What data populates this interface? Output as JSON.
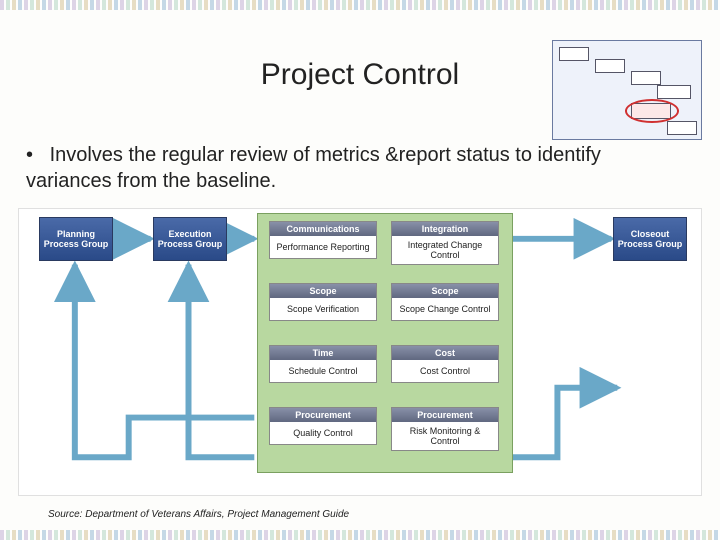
{
  "title": "Project Control",
  "bullet": "Involves the regular review of metrics &report status to identify variances from the baseline.",
  "source": "Source: Department of Veterans Affairs, Project Management Guide",
  "thumb": {
    "boxes": [
      "",
      "",
      "",
      "",
      "",
      ""
    ],
    "highlight_index": 4
  },
  "diagram": {
    "left_box": "Planning Process Group",
    "mid_left_box": "Execution Process Group",
    "right_box": "Closeout Process Group",
    "cells": [
      {
        "hdr": "Communications",
        "body": "Performance Reporting"
      },
      {
        "hdr": "Integration",
        "body": "Integrated Change Control"
      },
      {
        "hdr": "Scope",
        "body": "Scope Verification"
      },
      {
        "hdr": "Scope",
        "body": "Scope Change Control"
      },
      {
        "hdr": "Time",
        "body": "Schedule Control"
      },
      {
        "hdr": "Cost",
        "body": "Cost Control"
      },
      {
        "hdr": "Procurement",
        "body": "Quality Control"
      },
      {
        "hdr": "Procurement",
        "body": "Risk Monitoring & Control"
      }
    ]
  }
}
